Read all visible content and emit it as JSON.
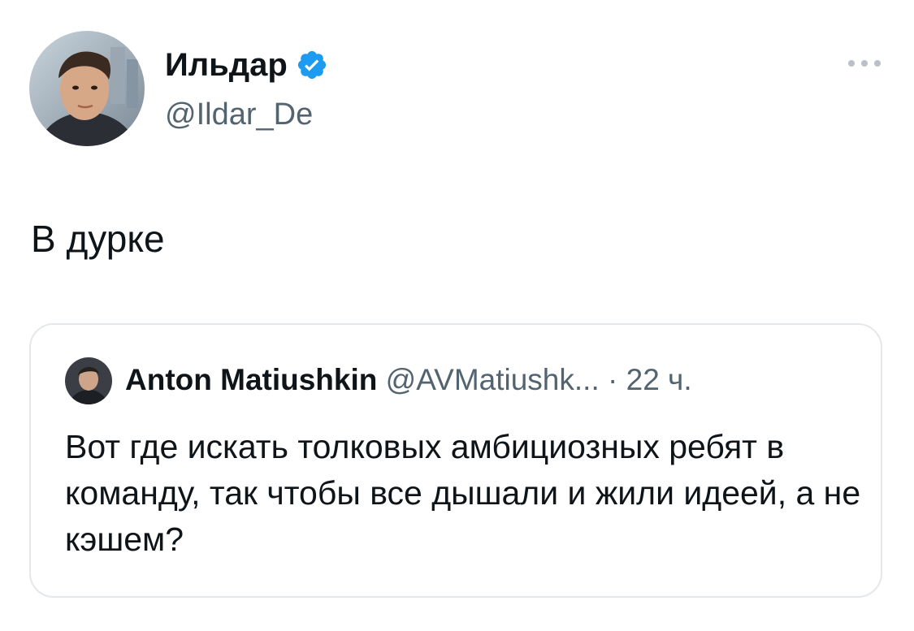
{
  "author": {
    "name": "Ильдар",
    "handle": "@Ildar_De",
    "verified": true,
    "avatar": "avatar-photo"
  },
  "tweet": {
    "text": "В дурке"
  },
  "menu": {
    "icon": "more-horizontal-icon"
  },
  "quote": {
    "name": "Anton Matiushkin",
    "handle": "@AVMatiushk...",
    "separator": "·",
    "time": "22 ч.",
    "avatar": "avatar-photo",
    "text": "Вот где искать толковых амбициозных ребят в команду, так чтобы все дышали и жили идеей, а не кэшем?"
  },
  "colors": {
    "text_primary": "#0f1419",
    "text_secondary": "#536471",
    "verified_blue": "#1d9bf0",
    "border": "#e4e8eb"
  }
}
